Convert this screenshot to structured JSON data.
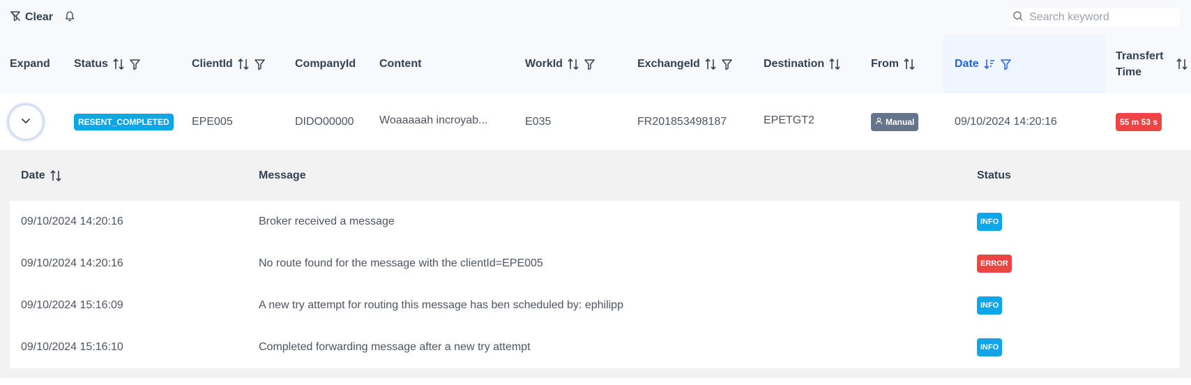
{
  "toolbar": {
    "clear_label": "Clear",
    "search_placeholder": "Search keyword"
  },
  "columns": {
    "expand": "Expand",
    "status": "Status",
    "clientId": "ClientId",
    "companyId": "CompanyId",
    "content": "Content",
    "workId": "WorkId",
    "exchangeId": "ExchangeId",
    "destination": "Destination",
    "from": "From",
    "date": "Date",
    "transfert_line1": "Transfert",
    "transfert_line2": "Time"
  },
  "row": {
    "status": "RESENT_COMPLETED",
    "clientId": "EPE005",
    "companyId": "DIDO00000",
    "content": "Woaaaaah incroyab...",
    "workId": "E035",
    "exchangeId": "FR201853498187",
    "destination": "EPETGT2",
    "from": "Manual",
    "date": "09/10/2024 14:20:16",
    "transfert_time": "55 m 53 s"
  },
  "detail": {
    "headers": {
      "date": "Date",
      "message": "Message",
      "status": "Status"
    },
    "rows": [
      {
        "date": "09/10/2024 14:20:16",
        "message": "Broker received a message",
        "status": "INFO"
      },
      {
        "date": "09/10/2024 14:20:16",
        "message": "No route found for the message with the clientId=EPE005",
        "status": "ERROR"
      },
      {
        "date": "09/10/2024 15:16:09",
        "message": "A new try attempt for routing this message has ben scheduled by: ephilipp",
        "status": "INFO"
      },
      {
        "date": "09/10/2024 15:16:10",
        "message": "Completed forwarding message after a new try attempt",
        "status": "INFO"
      }
    ]
  },
  "icons": {
    "clear": "filter-slash-icon",
    "bell": "bell-icon",
    "search": "search-icon",
    "sort": "sort-icon",
    "filter": "filter-icon",
    "chevron": "chevron-down-icon",
    "user": "user-icon"
  },
  "colors": {
    "info": "#0ea5e9",
    "error": "#ef4444",
    "manual": "#64748b",
    "accent": "#2563eb"
  }
}
